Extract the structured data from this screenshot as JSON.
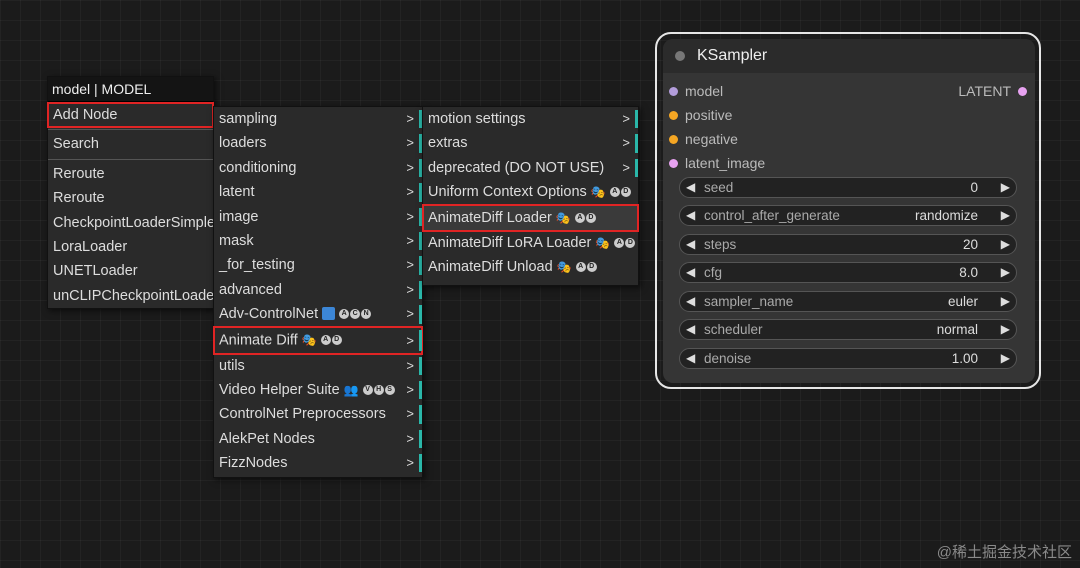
{
  "main_menu": {
    "title": "model | MODEL",
    "add_node": "Add Node",
    "search": "Search",
    "items": [
      "Reroute",
      "Reroute",
      "CheckpointLoaderSimple",
      "LoraLoader",
      "UNETLoader",
      "unCLIPCheckpointLoader"
    ]
  },
  "category_menu": {
    "items": [
      {
        "label": "sampling",
        "arrow": ">"
      },
      {
        "label": "loaders",
        "arrow": ">"
      },
      {
        "label": "conditioning",
        "arrow": ">"
      },
      {
        "label": "latent",
        "arrow": ">"
      },
      {
        "label": "image",
        "arrow": ">"
      },
      {
        "label": "mask",
        "arrow": ">"
      },
      {
        "label": "_for_testing",
        "arrow": ">"
      },
      {
        "label": "advanced",
        "arrow": ">"
      },
      {
        "label": "Adv-ControlNet",
        "arrow": ">",
        "badge": "ACN"
      },
      {
        "label": "Animate Diff",
        "arrow": ">",
        "badge": "AD"
      },
      {
        "label": "utils",
        "arrow": ">"
      },
      {
        "label": "Video Helper Suite",
        "arrow": ">",
        "badge": "VHS"
      },
      {
        "label": "ControlNet Preprocessors",
        "arrow": ">"
      },
      {
        "label": "AlekPet Nodes",
        "arrow": ">"
      },
      {
        "label": "FizzNodes",
        "arrow": ">"
      }
    ]
  },
  "animatediff_menu": {
    "items": [
      {
        "label": "motion settings",
        "arrow": ">"
      },
      {
        "label": "extras",
        "arrow": ">"
      },
      {
        "label": "deprecated (DO NOT USE)",
        "arrow": ">"
      },
      {
        "label": "Uniform Context Options",
        "badge": "AD"
      },
      {
        "label": "AnimateDiff Loader",
        "badge": "AD"
      },
      {
        "label": "AnimateDiff LoRA Loader",
        "badge": "AD"
      },
      {
        "label": "AnimateDiff Unload",
        "badge": "AD"
      }
    ]
  },
  "ksampler": {
    "title": "KSampler",
    "inputs": [
      {
        "name": "model",
        "color": "#b39ddb"
      },
      {
        "name": "positive",
        "color": "#f5a623"
      },
      {
        "name": "negative",
        "color": "#f5a623"
      },
      {
        "name": "latent_image",
        "color": "#e7a2f0"
      }
    ],
    "output": {
      "name": "LATENT",
      "color": "#e7a2f0"
    },
    "widgets": [
      {
        "name": "seed",
        "value": "0"
      },
      {
        "name": "control_after_generate",
        "value": "randomize"
      },
      {
        "name": "steps",
        "value": "20"
      },
      {
        "name": "cfg",
        "value": "8.0"
      },
      {
        "name": "sampler_name",
        "value": "euler"
      },
      {
        "name": "scheduler",
        "value": "normal"
      },
      {
        "name": "denoise",
        "value": "1.00"
      }
    ]
  },
  "watermark": "@稀土掘金技术社区"
}
